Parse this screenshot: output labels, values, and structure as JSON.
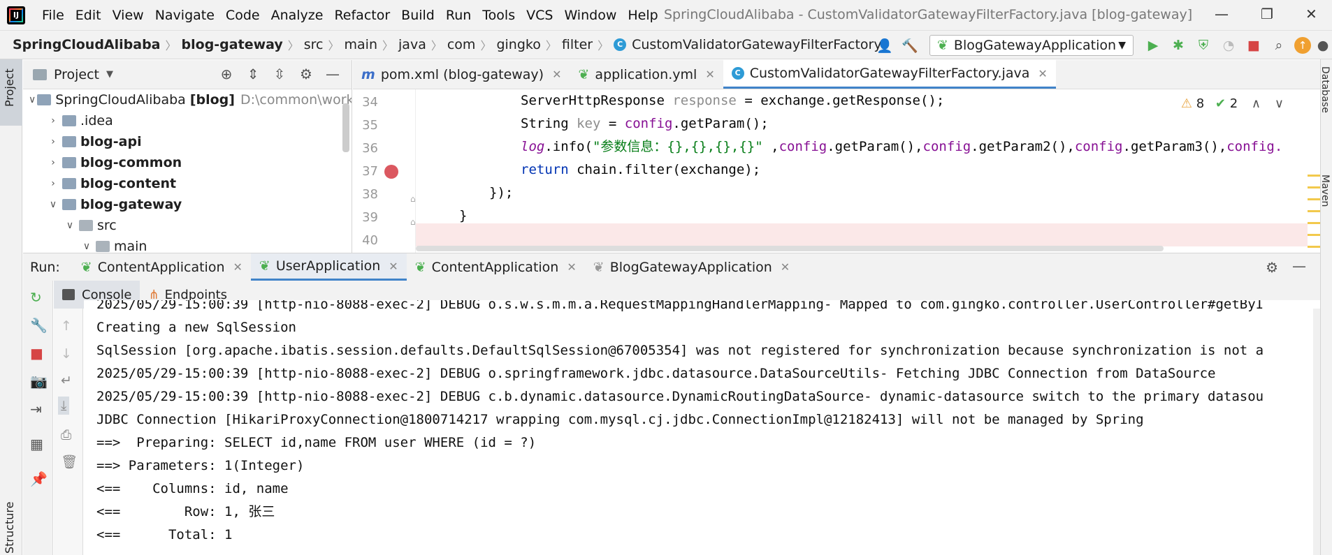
{
  "menu": [
    "File",
    "Edit",
    "View",
    "Navigate",
    "Code",
    "Analyze",
    "Refactor",
    "Build",
    "Run",
    "Tools",
    "VCS",
    "Window",
    "Help"
  ],
  "window_title": "SpringCloudAlibaba - CustomValidatorGatewayFilterFactory.java [blog-gateway]",
  "breadcrumbs": [
    "SpringCloudAlibaba",
    "blog-gateway",
    "src",
    "main",
    "java",
    "com",
    "gingko",
    "filter",
    "CustomValidatorGatewayFilterFactory"
  ],
  "run_config": "BlogGatewayApplication",
  "stripe": {
    "project": "Project",
    "structure": "Structure",
    "database": "Database",
    "maven": "Maven"
  },
  "project": {
    "title": "Project",
    "tree": [
      {
        "label": "SpringCloudAlibaba",
        "suffix": "[blog]",
        "path": "D:\\common\\works",
        "indent": 0,
        "arrow": "open",
        "bold": false
      },
      {
        "label": ".idea",
        "indent": 1,
        "arrow": "closed",
        "bold": false
      },
      {
        "label": "blog-api",
        "indent": 1,
        "arrow": "closed",
        "bold": true
      },
      {
        "label": "blog-common",
        "indent": 1,
        "arrow": "closed",
        "bold": true
      },
      {
        "label": "blog-content",
        "indent": 1,
        "arrow": "closed",
        "bold": true
      },
      {
        "label": "blog-gateway",
        "indent": 1,
        "arrow": "open",
        "bold": true
      },
      {
        "label": "src",
        "indent": 2,
        "arrow": "open",
        "bold": false
      },
      {
        "label": "main",
        "indent": 3,
        "arrow": "open",
        "bold": false
      }
    ]
  },
  "editor": {
    "tabs": [
      {
        "label": "pom.xml (blog-gateway)",
        "icon": "m",
        "active": false
      },
      {
        "label": "application.yml",
        "icon": "leaf",
        "active": false
      },
      {
        "label": "CustomValidatorGatewayFilterFactory.java",
        "icon": "C",
        "active": true
      }
    ],
    "line_numbers": [
      "34",
      "35",
      "36",
      "37",
      "38",
      "39",
      "40"
    ],
    "inspections": {
      "warnings": "8",
      "ok": "2"
    },
    "code": {
      "l34_type": "ServerHttpResponse",
      "l34_var": "response",
      "l34_rest": " = exchange.getResponse();",
      "l35_type": "String",
      "l35_var": "key",
      "l35_eq": " = ",
      "l35_cfg": "config",
      "l35_rest": ".getParam();",
      "l36_log": "log",
      "l36_info": ".info(",
      "l36_str": "\"参数信息：{},{},{},{}\"",
      "l36_sep": " ,",
      "l36_c1": "config",
      "l36_m1": ".getParam(),",
      "l36_c2": "config",
      "l36_m2": ".getParam2(),",
      "l36_c3": "config",
      "l36_m3": ".getParam3(),",
      "l36_c4": "config.",
      "l37_kw": "return",
      "l37_rest": " chain.filter(exchange);",
      "l38": "});",
      "l39": "}"
    }
  },
  "run": {
    "label": "Run:",
    "tabs": [
      {
        "label": "ContentApplication",
        "active": false
      },
      {
        "label": "UserApplication",
        "active": true
      },
      {
        "label": "ContentApplication",
        "active": false
      },
      {
        "label": "BlogGatewayApplication",
        "active": false
      }
    ],
    "subtabs": [
      "Console",
      "Endpoints"
    ],
    "console_lines": [
      "2025/05/29-15:00:39 [http-nio-8088-exec-2] DEBUG o.s.w.s.m.m.a.RequestMappingHandlerMapping- Mapped to com.gingko.controller.UserController#getByI",
      "Creating a new SqlSession",
      "SqlSession [org.apache.ibatis.session.defaults.DefaultSqlSession@67005354] was not registered for synchronization because synchronization is not a",
      "2025/05/29-15:00:39 [http-nio-8088-exec-2] DEBUG o.springframework.jdbc.datasource.DataSourceUtils- Fetching JDBC Connection from DataSource",
      "2025/05/29-15:00:39 [http-nio-8088-exec-2] DEBUG c.b.dynamic.datasource.DynamicRoutingDataSource- dynamic-datasource switch to the primary datasou",
      "JDBC Connection [HikariProxyConnection@1800714217 wrapping com.mysql.cj.jdbc.ConnectionImpl@12182413] will not be managed by Spring",
      "==>  Preparing: SELECT id,name FROM user WHERE (id = ?)",
      "==> Parameters: 1(Integer)",
      "<==    Columns: id, name",
      "<==        Row: 1, 张三",
      "<==      Total: 1"
    ]
  }
}
